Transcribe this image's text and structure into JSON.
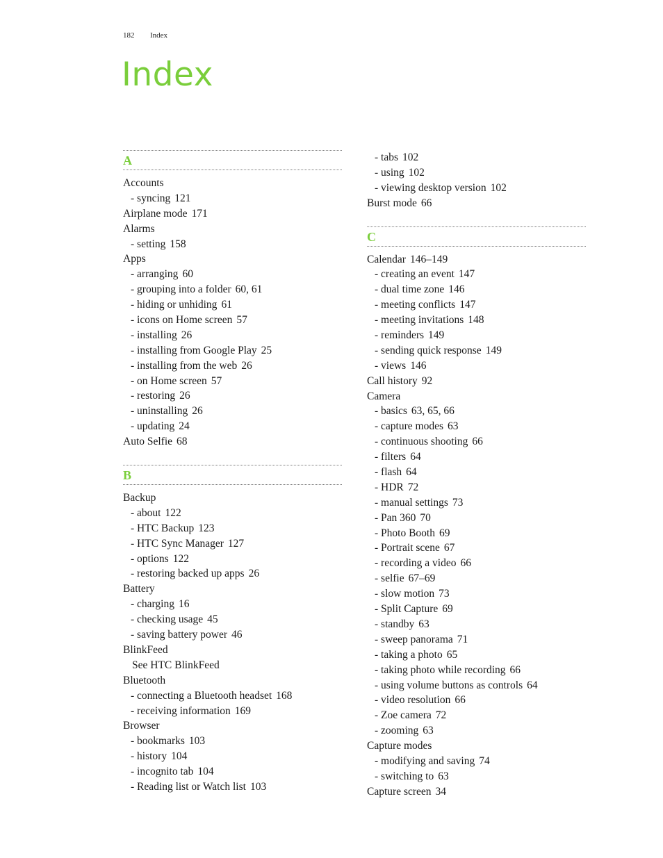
{
  "running_head": {
    "page_number": "182",
    "section": "Index"
  },
  "title": "Index",
  "accent_color": "#7ace3b",
  "left_column": [
    {
      "type": "letter",
      "text": "A"
    },
    {
      "type": "main",
      "text": "Accounts",
      "pages": ""
    },
    {
      "type": "sub",
      "text": "- syncing",
      "pages": "121"
    },
    {
      "type": "main",
      "text": "Airplane mode",
      "pages": "171"
    },
    {
      "type": "main",
      "text": "Alarms",
      "pages": ""
    },
    {
      "type": "sub",
      "text": "- setting",
      "pages": "158"
    },
    {
      "type": "main",
      "text": "Apps",
      "pages": ""
    },
    {
      "type": "sub",
      "text": "- arranging",
      "pages": "60"
    },
    {
      "type": "sub",
      "text": "- grouping into a folder",
      "pages": "60, 61"
    },
    {
      "type": "sub",
      "text": "- hiding or unhiding",
      "pages": "61"
    },
    {
      "type": "sub",
      "text": "- icons on Home screen",
      "pages": "57"
    },
    {
      "type": "sub",
      "text": "- installing",
      "pages": "26"
    },
    {
      "type": "sub",
      "text": "- installing from Google Play",
      "pages": "25"
    },
    {
      "type": "sub",
      "text": "- installing from the web",
      "pages": "26"
    },
    {
      "type": "sub",
      "text": "- on Home screen",
      "pages": "57"
    },
    {
      "type": "sub",
      "text": "- restoring",
      "pages": "26"
    },
    {
      "type": "sub",
      "text": "- uninstalling",
      "pages": "26"
    },
    {
      "type": "sub",
      "text": "- updating",
      "pages": "24"
    },
    {
      "type": "main",
      "text": "Auto Selfie",
      "pages": "68"
    },
    {
      "type": "gap"
    },
    {
      "type": "letter",
      "text": "B"
    },
    {
      "type": "main",
      "text": "Backup",
      "pages": ""
    },
    {
      "type": "sub",
      "text": "- about",
      "pages": "122"
    },
    {
      "type": "sub",
      "text": "- HTC Backup",
      "pages": "123"
    },
    {
      "type": "sub",
      "text": "- HTC Sync Manager",
      "pages": "127"
    },
    {
      "type": "sub",
      "text": "- options",
      "pages": "122"
    },
    {
      "type": "sub",
      "text": "- restoring backed up apps",
      "pages": "26"
    },
    {
      "type": "main",
      "text": "Battery",
      "pages": ""
    },
    {
      "type": "sub",
      "text": "- charging",
      "pages": "16"
    },
    {
      "type": "sub",
      "text": "- checking usage",
      "pages": "45"
    },
    {
      "type": "sub",
      "text": "- saving battery power",
      "pages": "46"
    },
    {
      "type": "main",
      "text": "BlinkFeed",
      "pages": ""
    },
    {
      "type": "see",
      "text": "See HTC BlinkFeed",
      "pages": ""
    },
    {
      "type": "main",
      "text": "Bluetooth",
      "pages": ""
    },
    {
      "type": "sub",
      "text": "- connecting a Bluetooth headset",
      "pages": "168"
    },
    {
      "type": "sub",
      "text": "- receiving information",
      "pages": "169"
    },
    {
      "type": "main",
      "text": "Browser",
      "pages": ""
    },
    {
      "type": "sub",
      "text": "- bookmarks",
      "pages": "103"
    },
    {
      "type": "sub",
      "text": "- history",
      "pages": "104"
    },
    {
      "type": "sub",
      "text": "- incognito tab",
      "pages": "104"
    },
    {
      "type": "sub",
      "text": "- Reading list or Watch list",
      "pages": "103"
    }
  ],
  "right_column": [
    {
      "type": "sub",
      "text": "- tabs",
      "pages": "102"
    },
    {
      "type": "sub",
      "text": "- using",
      "pages": "102"
    },
    {
      "type": "sub",
      "text": "- viewing desktop version",
      "pages": "102"
    },
    {
      "type": "main",
      "text": "Burst mode",
      "pages": "66"
    },
    {
      "type": "gap"
    },
    {
      "type": "letter",
      "text": "C"
    },
    {
      "type": "main",
      "text": "Calendar",
      "pages": "146–149"
    },
    {
      "type": "sub",
      "text": "- creating an event",
      "pages": "147"
    },
    {
      "type": "sub",
      "text": "- dual time zone",
      "pages": "146"
    },
    {
      "type": "sub",
      "text": "- meeting conflicts",
      "pages": "147"
    },
    {
      "type": "sub",
      "text": "- meeting invitations",
      "pages": "148"
    },
    {
      "type": "sub",
      "text": "- reminders",
      "pages": "149"
    },
    {
      "type": "sub",
      "text": "- sending quick response",
      "pages": "149"
    },
    {
      "type": "sub",
      "text": "- views",
      "pages": "146"
    },
    {
      "type": "main",
      "text": "Call history",
      "pages": "92"
    },
    {
      "type": "main",
      "text": "Camera",
      "pages": ""
    },
    {
      "type": "sub",
      "text": "- basics",
      "pages": "63, 65, 66"
    },
    {
      "type": "sub",
      "text": "- capture modes",
      "pages": "63"
    },
    {
      "type": "sub",
      "text": "- continuous shooting",
      "pages": "66"
    },
    {
      "type": "sub",
      "text": "- filters",
      "pages": "64"
    },
    {
      "type": "sub",
      "text": "- flash",
      "pages": "64"
    },
    {
      "type": "sub",
      "text": "- HDR",
      "pages": "72"
    },
    {
      "type": "sub",
      "text": "- manual settings",
      "pages": "73"
    },
    {
      "type": "sub",
      "text": "- Pan 360",
      "pages": "70"
    },
    {
      "type": "sub",
      "text": "- Photo Booth",
      "pages": "69"
    },
    {
      "type": "sub",
      "text": "- Portrait scene",
      "pages": "67"
    },
    {
      "type": "sub",
      "text": "- recording a video",
      "pages": "66"
    },
    {
      "type": "sub",
      "text": "- selfie",
      "pages": "67–69"
    },
    {
      "type": "sub",
      "text": "- slow motion",
      "pages": "73"
    },
    {
      "type": "sub",
      "text": "- Split Capture",
      "pages": "69"
    },
    {
      "type": "sub",
      "text": "- standby",
      "pages": "63"
    },
    {
      "type": "sub",
      "text": "- sweep panorama",
      "pages": "71"
    },
    {
      "type": "sub",
      "text": "- taking a photo",
      "pages": "65"
    },
    {
      "type": "sub",
      "text": "- taking photo while recording",
      "pages": "66"
    },
    {
      "type": "sub",
      "text": "- using volume buttons as controls",
      "pages": "64"
    },
    {
      "type": "sub",
      "text": "- video resolution",
      "pages": "66"
    },
    {
      "type": "sub",
      "text": "- Zoe camera",
      "pages": "72"
    },
    {
      "type": "sub",
      "text": "- zooming",
      "pages": "63"
    },
    {
      "type": "main",
      "text": "Capture modes",
      "pages": ""
    },
    {
      "type": "sub",
      "text": "- modifying and saving",
      "pages": "74"
    },
    {
      "type": "sub",
      "text": "- switching to",
      "pages": "63"
    },
    {
      "type": "main",
      "text": "Capture screen",
      "pages": "34"
    }
  ]
}
